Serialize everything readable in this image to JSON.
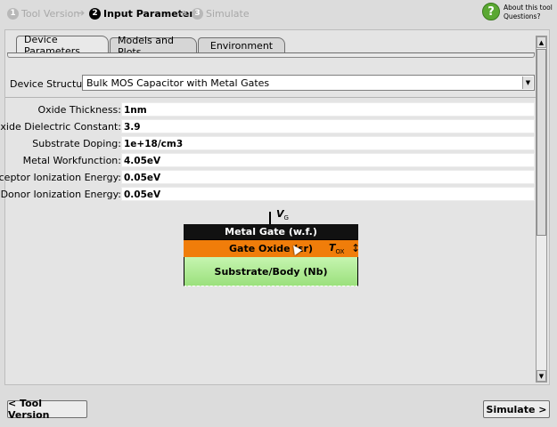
{
  "wizard": {
    "steps": [
      {
        "num": "1",
        "label": "Tool Version",
        "state": "inactive"
      },
      {
        "num": "2",
        "label": "Input Parameters",
        "state": "active"
      },
      {
        "num": "3",
        "label": "Simulate",
        "state": "inactive"
      }
    ],
    "arrow": "➔",
    "help": {
      "line1": "About this tool",
      "line2": "Questions?",
      "icon_glyph": "?"
    }
  },
  "tabs": [
    {
      "label": "Device Parameters",
      "active": true
    },
    {
      "label": "Models and Plots",
      "active": false
    },
    {
      "label": "Environment",
      "active": false
    }
  ],
  "structure": {
    "label": "Device Structure:",
    "value": "Bulk MOS Capacitor with Metal Gates",
    "dropdown_glyph": "▼"
  },
  "params": [
    {
      "label": "Oxide Thickness:",
      "value": "1nm"
    },
    {
      "label": "Oxide Dielectric Constant:",
      "value": "3.9"
    },
    {
      "label": "Substrate Doping:",
      "value": "1e+18/cm3"
    },
    {
      "label": "Metal Workfunction:",
      "value": "4.05eV"
    },
    {
      "label": "Acceptor Ionization Energy:",
      "value": "0.05eV"
    },
    {
      "label": "Donor Ionization Energy:",
      "value": "0.05eV"
    }
  ],
  "diagram": {
    "vg_main": "V",
    "vg_sub": "G",
    "metal": "Metal Gate (w.f.)",
    "oxide": "Gate Oxide (εr)",
    "tox_main": "T",
    "tox_sub": "OX",
    "tox_arrow": "↕",
    "substrate": "Substrate/Body (Nb)"
  },
  "scroll": {
    "up_glyph": "▲",
    "down_glyph": "▼"
  },
  "buttons": {
    "back": "< Tool Version",
    "next": "Simulate >"
  },
  "colors": {
    "metal": "#111111",
    "oxide": "#f07d0a",
    "substrate": "#b5eb98",
    "help_icon": "#5aa832"
  }
}
